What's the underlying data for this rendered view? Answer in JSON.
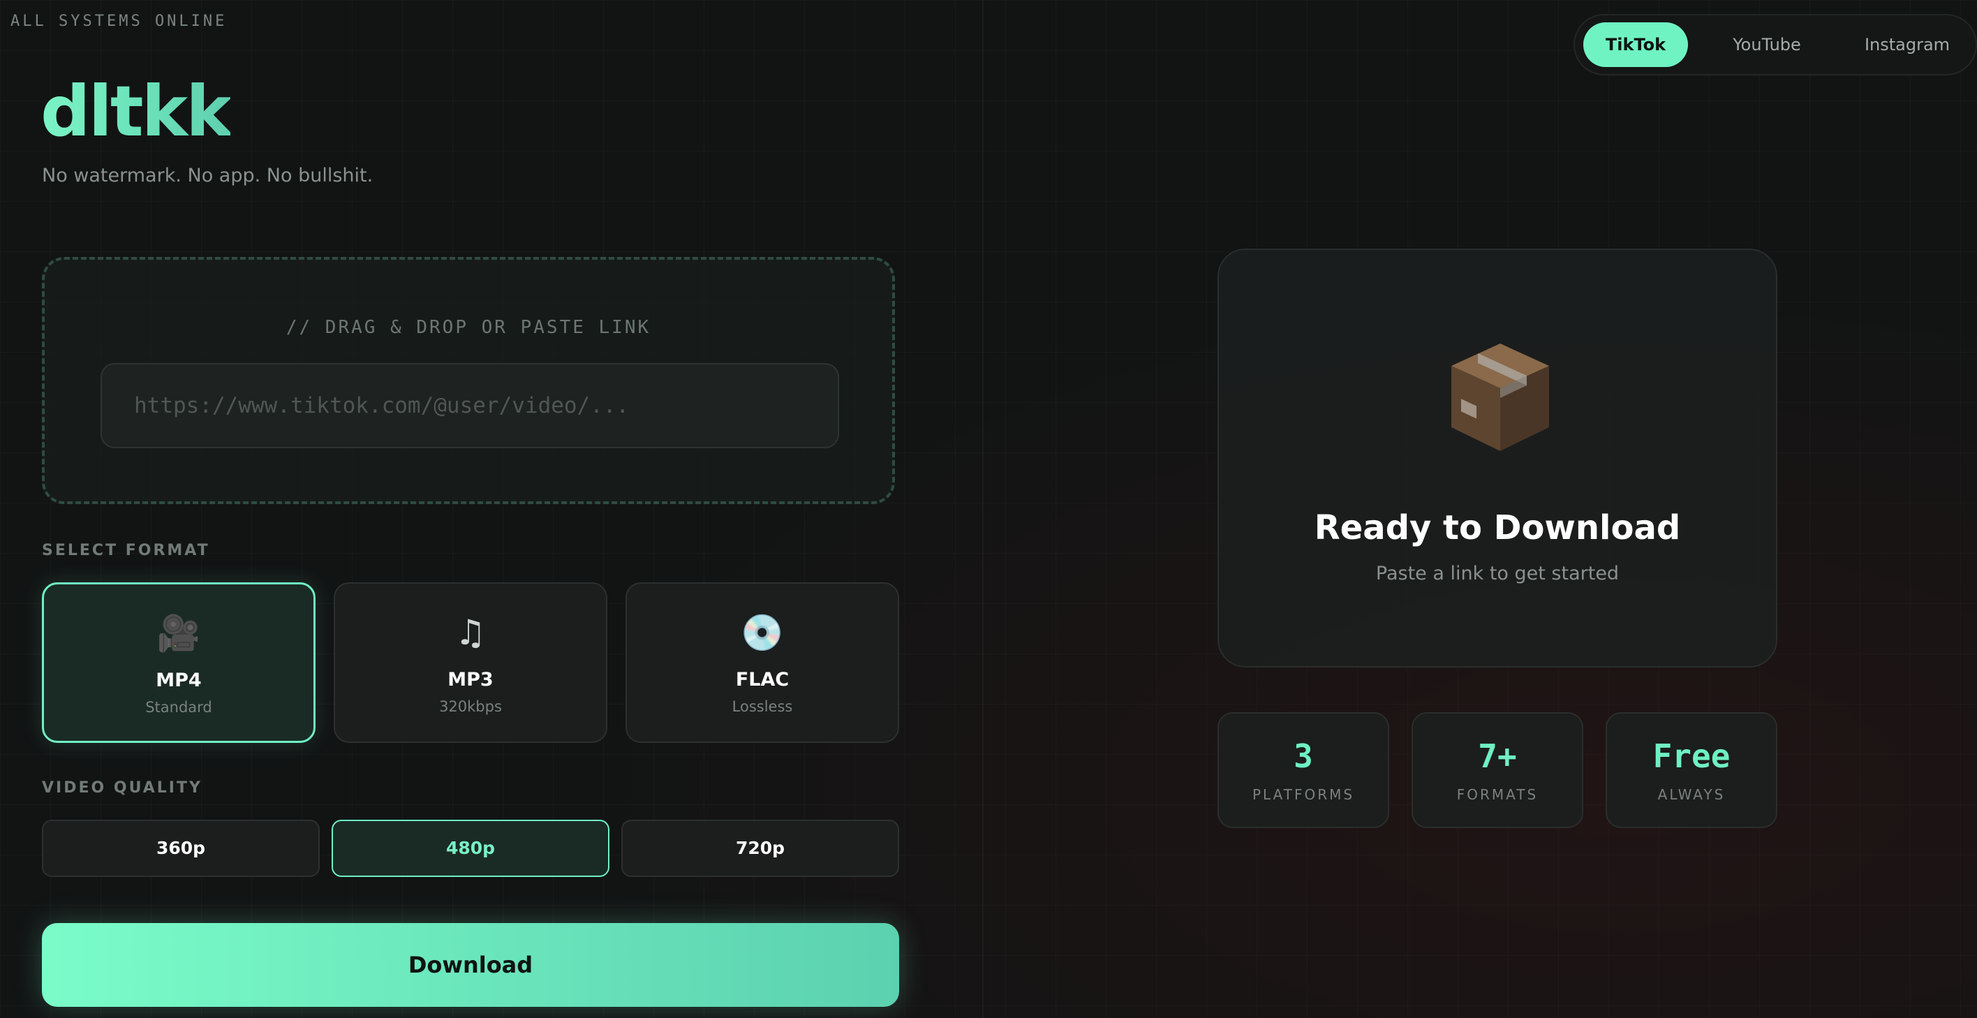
{
  "status": {
    "text": "ALL SYSTEMS ONLINE"
  },
  "brand": {
    "logo": "dltkk",
    "tagline": "No watermark. No app. No bullshit."
  },
  "platform_tabs": [
    {
      "label": "TikTok",
      "active": true
    },
    {
      "label": "YouTube",
      "active": false
    },
    {
      "label": "Instagram",
      "active": false
    }
  ],
  "dropzone": {
    "label": "// DRAG & DROP OR PASTE LINK",
    "input_value": "",
    "input_placeholder": "https://www.tiktok.com/@user/video/..."
  },
  "format": {
    "section_label": "SELECT FORMAT",
    "options": [
      {
        "icon": "video-camera-icon",
        "glyph": "🎥",
        "name": "MP4",
        "sub": "Standard",
        "active": true
      },
      {
        "icon": "music-note-icon",
        "glyph": "♫",
        "name": "MP3",
        "sub": "320kbps",
        "active": false
      },
      {
        "icon": "disc-icon",
        "glyph": "💿",
        "name": "FLAC",
        "sub": "Lossless",
        "active": false
      }
    ]
  },
  "quality": {
    "section_label": "VIDEO QUALITY",
    "options": [
      {
        "label": "360p",
        "active": false
      },
      {
        "label": "480p",
        "active": true
      },
      {
        "label": "720p",
        "active": false
      }
    ]
  },
  "download": {
    "label": "Download"
  },
  "ready": {
    "icon": "package-box-icon",
    "title": "Ready to Download",
    "subtitle": "Paste a link to get started"
  },
  "stats": [
    {
      "value": "3",
      "label": "PLATFORMS"
    },
    {
      "value": "7+",
      "label": "FORMATS"
    },
    {
      "value": "Free",
      "label": "ALWAYS"
    }
  ],
  "colors": {
    "accent": "#6ff0c2",
    "background": "#121414"
  }
}
